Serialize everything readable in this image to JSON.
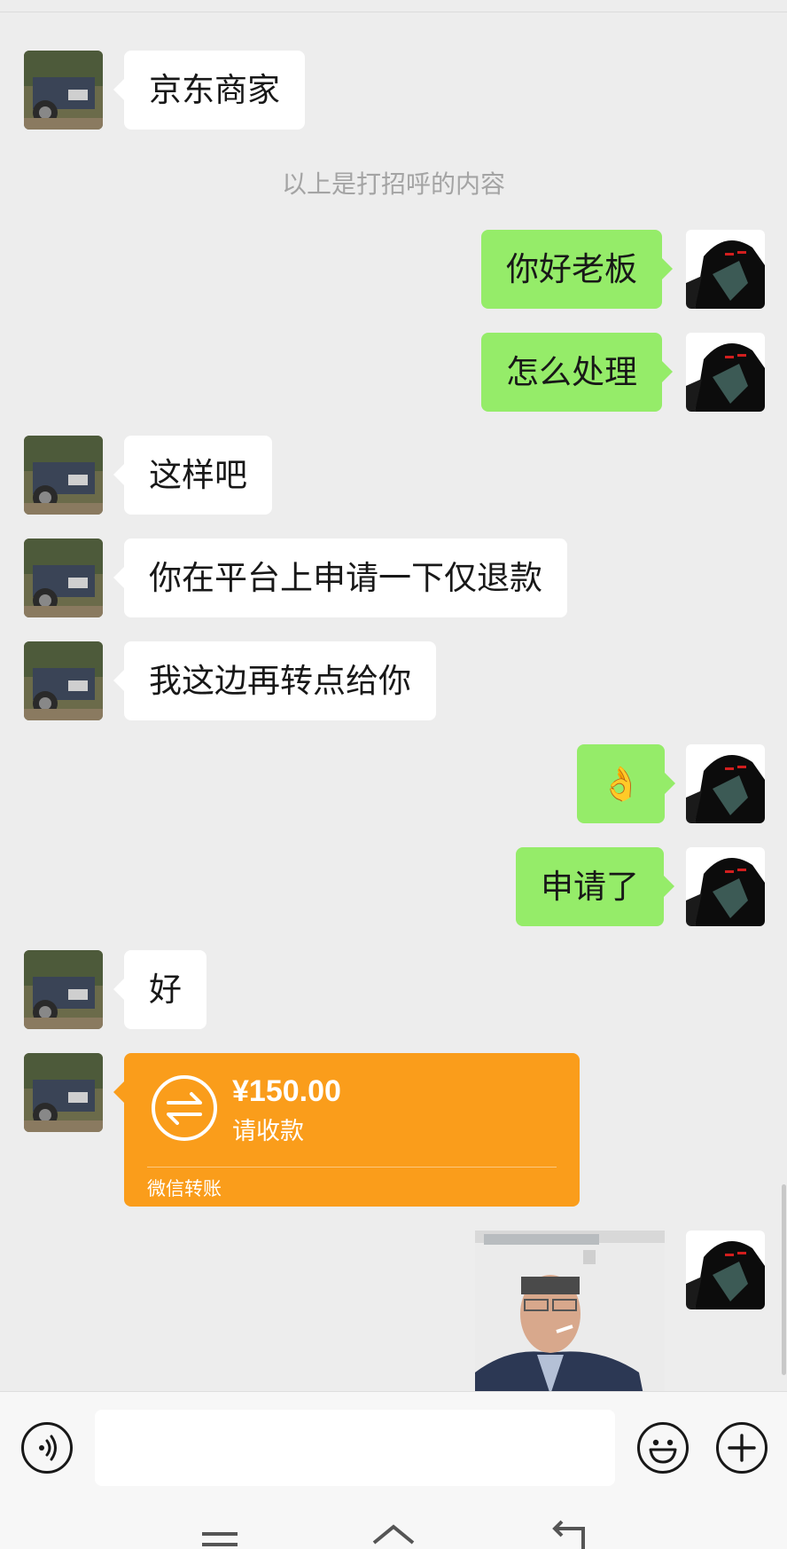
{
  "messages": [
    {
      "side": "left",
      "type": "text",
      "text": "京东商家"
    },
    {
      "type": "system",
      "text": "以上是打招呼的内容"
    },
    {
      "side": "right",
      "type": "text",
      "text": "你好老板"
    },
    {
      "side": "right",
      "type": "text",
      "text": "怎么处理"
    },
    {
      "side": "left",
      "type": "text",
      "text": "这样吧"
    },
    {
      "side": "left",
      "type": "text",
      "text": "你在平台上申请一下仅退款"
    },
    {
      "side": "left",
      "type": "text",
      "text": "我这边再转点给你"
    },
    {
      "side": "right",
      "type": "emoji",
      "text": "👌"
    },
    {
      "side": "right",
      "type": "text",
      "text": "申请了"
    },
    {
      "side": "left",
      "type": "text",
      "text": "好"
    },
    {
      "side": "left",
      "type": "transfer",
      "amount": "¥150.00",
      "status": "请收款",
      "brand": "微信转账"
    },
    {
      "side": "right",
      "type": "image"
    }
  ],
  "colors": {
    "background": "#ededed",
    "bubble_left": "#ffffff",
    "bubble_right": "#95ec69",
    "transfer": "#fa9d1b"
  },
  "input_bar": {
    "voice_icon": "voice-icon",
    "emoji_icon": "emoji-icon",
    "plus_icon": "plus-icon",
    "text_value": ""
  },
  "nav": {
    "icons": [
      "menu-icon",
      "home-icon",
      "back-icon"
    ]
  }
}
